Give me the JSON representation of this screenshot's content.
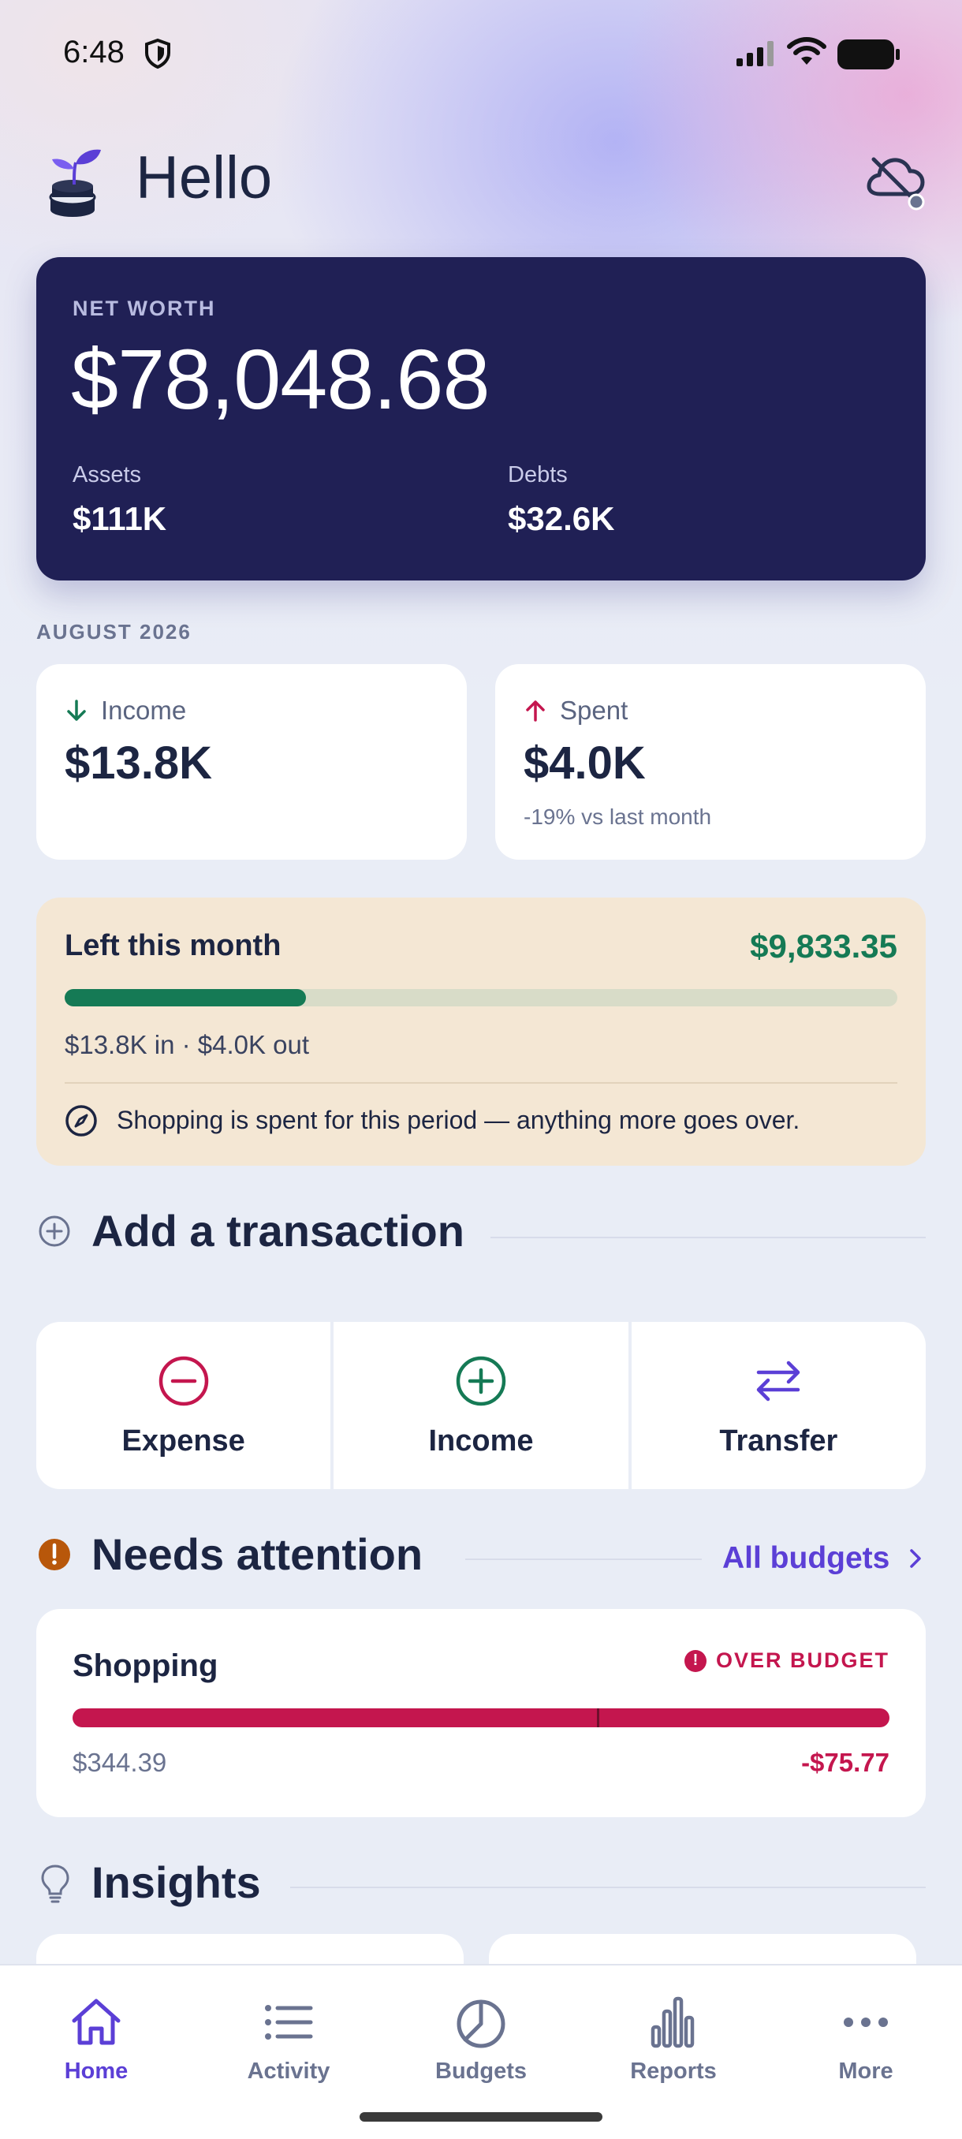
{
  "status_bar": {
    "time": "6:48"
  },
  "header": {
    "greeting": "Hello"
  },
  "net_worth": {
    "label": "NET WORTH",
    "value": "$78,048.68",
    "assets_label": "Assets",
    "assets_value": "$111K",
    "debts_label": "Debts",
    "debts_value": "$32.6K"
  },
  "period": {
    "label": "AUGUST 2026"
  },
  "income_card": {
    "title": "Income",
    "value": "$13.8K"
  },
  "spent_card": {
    "title": "Spent",
    "value": "$4.0K",
    "comparison": "-19% vs last month"
  },
  "left_this_month": {
    "title": "Left this month",
    "amount": "$9,833.35",
    "progress_fraction": 0.29,
    "summary": "$13.8K in · $4.0K out",
    "note": "Shopping is spent for this period — anything more goes over."
  },
  "add_transaction": {
    "title": "Add a transaction",
    "actions": [
      {
        "label": "Expense",
        "icon": "minus-circle-icon"
      },
      {
        "label": "Income",
        "icon": "plus-circle-icon"
      },
      {
        "label": "Transfer",
        "icon": "transfer-arrows-icon"
      }
    ]
  },
  "needs_attention": {
    "title": "Needs attention",
    "link": "All budgets",
    "budget": {
      "name": "Shopping",
      "badge": "OVER BUDGET",
      "spent": "$344.39",
      "difference": "-$75.77",
      "budget_limit_fraction": 0.642
    }
  },
  "insights": {
    "title": "Insights"
  },
  "tabs": [
    {
      "label": "Home",
      "icon": "home-icon",
      "active": true
    },
    {
      "label": "Activity",
      "icon": "list-icon",
      "active": false
    },
    {
      "label": "Budgets",
      "icon": "pie-chart-icon",
      "active": false
    },
    {
      "label": "Reports",
      "icon": "bar-chart-icon",
      "active": false
    },
    {
      "label": "More",
      "icon": "more-dots-icon",
      "active": false
    }
  ],
  "colors": {
    "accent": "#5b3fd6",
    "networth_bg": "#202055",
    "positive": "#157a55",
    "negative": "#c4164e",
    "warning": "#b8570a"
  }
}
